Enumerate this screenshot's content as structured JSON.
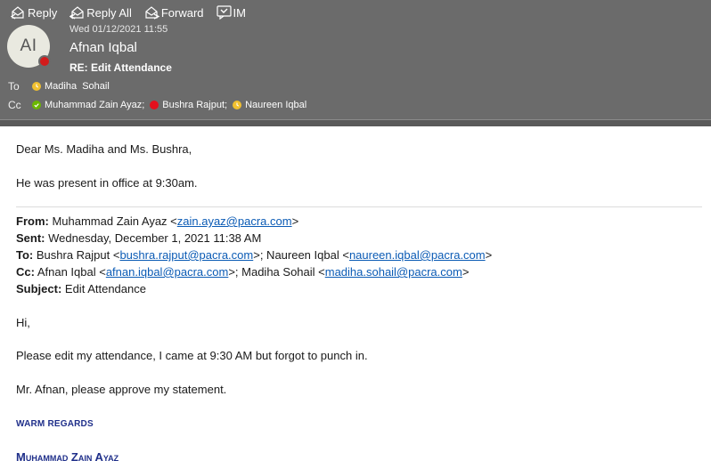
{
  "toolbar": {
    "reply": "Reply",
    "reply_all": "Reply All",
    "forward": "Forward",
    "im": "IM"
  },
  "message": {
    "avatar_initials": "AI",
    "date": "Wed 01/12/2021 11:55",
    "sender": "Afnan Iqbal",
    "subject": "RE: Edit Attendance",
    "to_label": "To",
    "cc_label": "Cc",
    "to": [
      {
        "name": "Madiha  Sohail",
        "status": "away"
      }
    ],
    "cc": [
      {
        "name": "Muhammad Zain Ayaz;",
        "status": "available"
      },
      {
        "name": "Bushra Rajput;",
        "status": "busy"
      },
      {
        "name": "Naureen Iqbal",
        "status": "away"
      }
    ]
  },
  "body": {
    "greeting": "Dear Ms. Madiha and Ms. Bushra,",
    "line1": "He was present in office at 9:30am.",
    "quoted": {
      "from_label": "From:",
      "from_name": " Muhammad Zain Ayaz <",
      "from_email": "zain.ayaz@pacra.com",
      "from_end": ">",
      "sent_label": "Sent:",
      "sent_value": " Wednesday, December 1, 2021 11:38 AM",
      "to_label": "To:",
      "to_name1": " Bushra Rajput <",
      "to_email1": "bushra.rajput@pacra.com",
      "to_mid": ">; Naureen Iqbal <",
      "to_email2": "naureen.iqbal@pacra.com",
      "to_end": ">",
      "cc_label": "Cc:",
      "cc_name1": " Afnan Iqbal <",
      "cc_email1": "afnan.iqbal@pacra.com",
      "cc_mid": ">; Madiha Sohail <",
      "cc_email2": "madiha.sohail@pacra.com",
      "cc_end": ">",
      "subject_label": "Subject:",
      "subject_value": " Edit Attendance"
    },
    "hi": "Hi,",
    "request": "Please edit my attendance, I came at 9:30 AM but forgot to punch in.",
    "approve": "Mr. Afnan, please approve my statement.",
    "regards": "WARM REGARDS",
    "signature": "Muhammad Zain Ayaz"
  },
  "colors": {
    "header_bg": "#6b6b6b",
    "link": "#0b5bb5",
    "signature": "#1f2f8a",
    "presence_busy": "#e3101d",
    "presence_away": "#f2c02f",
    "presence_available": "#6bb700"
  }
}
